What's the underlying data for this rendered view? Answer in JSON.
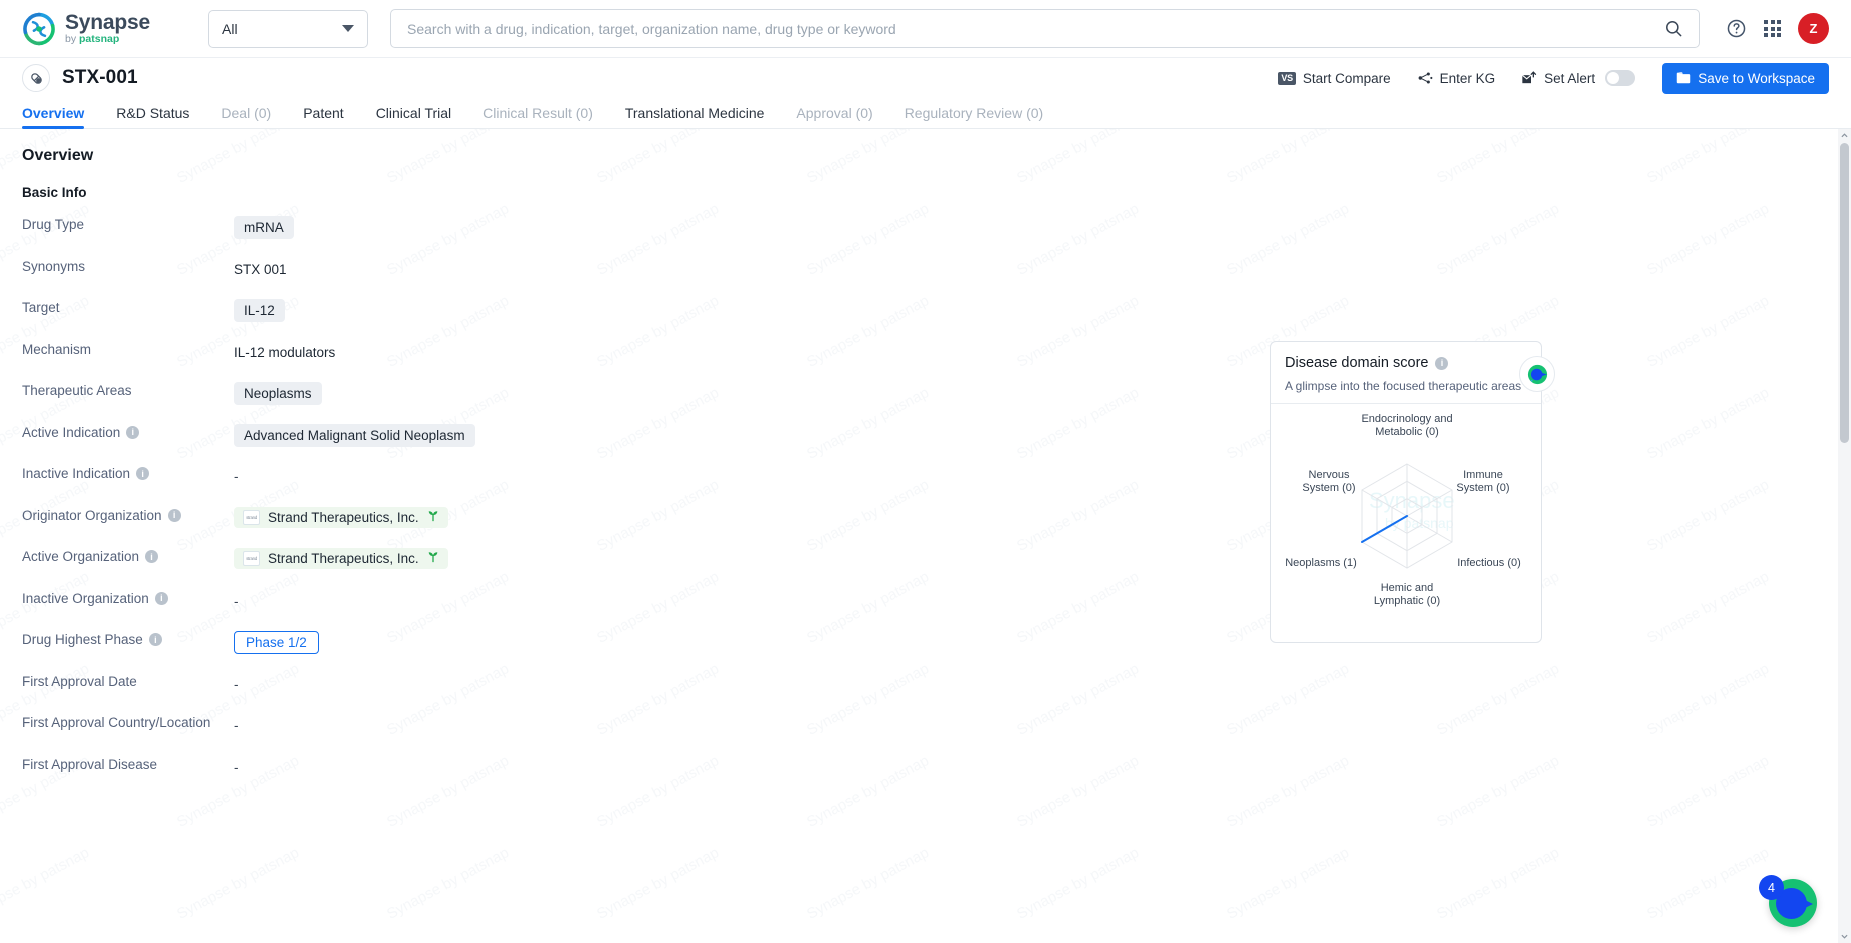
{
  "brand": {
    "name": "Synapse",
    "by": "by ",
    "patsnap": "patsnap",
    "logo_icon": "synapse-logo-icon"
  },
  "header": {
    "scope_selected": "All",
    "scope_options": [
      "All"
    ],
    "search_placeholder": "Search with a drug, indication, target, organization name, drug type or keyword",
    "search_value": "",
    "search_icon": "search-icon",
    "help_icon": "help-circle-icon",
    "apps_icon": "apps-grid-icon",
    "avatar_initial": "Z"
  },
  "page": {
    "drug_icon": "capsule-pill-icon",
    "title": "STX-001",
    "actions": {
      "start_compare": "Start Compare",
      "start_compare_badge": "VS",
      "enter_kg": "Enter KG",
      "enter_kg_icon": "knowledge-graph-icon",
      "set_alert": "Set Alert",
      "set_alert_icon": "alert-bell-icon",
      "alert_toggle_on": false,
      "save_to_workspace": "Save to Workspace",
      "save_icon": "folder-icon"
    }
  },
  "tabs": [
    {
      "label": "Overview",
      "state": "active"
    },
    {
      "label": "R&D Status",
      "state": "normal"
    },
    {
      "label": "Deal (0)",
      "state": "dim"
    },
    {
      "label": "Patent",
      "state": "normal"
    },
    {
      "label": "Clinical Trial",
      "state": "normal"
    },
    {
      "label": "Clinical Result (0)",
      "state": "dim"
    },
    {
      "label": "Translational Medicine",
      "state": "normal"
    },
    {
      "label": "Approval (0)",
      "state": "dim"
    },
    {
      "label": "Regulatory Review (0)",
      "state": "dim"
    }
  ],
  "overview": {
    "heading": "Overview",
    "section": "Basic Info",
    "rows": [
      {
        "label": "Drug Type",
        "info": false,
        "type": "chip",
        "value": "mRNA"
      },
      {
        "label": "Synonyms",
        "info": false,
        "type": "plain",
        "value": "STX 001"
      },
      {
        "label": "Target",
        "info": false,
        "type": "chip",
        "value": "IL-12"
      },
      {
        "label": "Mechanism",
        "info": false,
        "type": "plain",
        "value": "IL-12 modulators"
      },
      {
        "label": "Therapeutic Areas",
        "info": false,
        "type": "chip",
        "value": "Neoplasms"
      },
      {
        "label": "Active Indication",
        "info": true,
        "type": "chip",
        "value": "Advanced Malignant Solid Neoplasm"
      },
      {
        "label": "Inactive Indication",
        "info": true,
        "type": "dash",
        "value": "-"
      },
      {
        "label": "Originator Organization",
        "info": true,
        "type": "org",
        "value": "Strand Therapeutics, Inc.",
        "org_logo_text": "strand"
      },
      {
        "label": "Active Organization",
        "info": true,
        "type": "org",
        "value": "Strand Therapeutics, Inc.",
        "org_logo_text": "strand"
      },
      {
        "label": "Inactive Organization",
        "info": true,
        "type": "dash",
        "value": "-"
      },
      {
        "label": "Drug Highest Phase",
        "info": true,
        "type": "phase",
        "value": "Phase 1/2"
      },
      {
        "label": "First Approval Date",
        "info": false,
        "type": "dash",
        "value": "-"
      },
      {
        "label": "First Approval Country/Location",
        "info": false,
        "type": "dash",
        "value": "-"
      },
      {
        "label": "First Approval Disease",
        "info": false,
        "type": "dash",
        "value": "-"
      }
    ]
  },
  "disease_card": {
    "title": "Disease domain score",
    "info_icon": "info-icon",
    "subtitle": "A glimpse into the focused therapeutic areas",
    "float_icon": "assistant-icon"
  },
  "chart_data": {
    "type": "radar",
    "title": "Disease domain score",
    "subtitle": "A glimpse into the focused therapeutic areas",
    "categories": [
      "Endocrinology and Metabolic (0)",
      "Immune System (0)",
      "Infectious (0)",
      "Hemic and Lymphatic (0)",
      "Neoplasms (1)",
      "Nervous System (0)"
    ],
    "axis_names": [
      "Endocrinology and Metabolic",
      "Immune System",
      "Infectious",
      "Hemic and Lymphatic",
      "Neoplasms",
      "Nervous System"
    ],
    "values": [
      0,
      0,
      0,
      0,
      1,
      0
    ],
    "max": 1,
    "rings": 3,
    "grid": true,
    "legend": "none",
    "series_color": "#1570ef",
    "grid_color": "#e2e5e9",
    "label_color": "#3a4656"
  },
  "watermark": {
    "text": "Synapse by patsnap"
  },
  "float_widget": {
    "badge_count": "4",
    "icon": "chat-assistant-icon"
  },
  "scrollbar": {
    "up_icon": "chevron-up-icon",
    "down_icon": "chevron-down-icon"
  },
  "colors": {
    "accent": "#1570ef",
    "brand_green": "#24b47e",
    "avatar_red": "#d81f26",
    "chip_bg": "#eceff3",
    "org_chip_bg": "#eef7ee"
  }
}
